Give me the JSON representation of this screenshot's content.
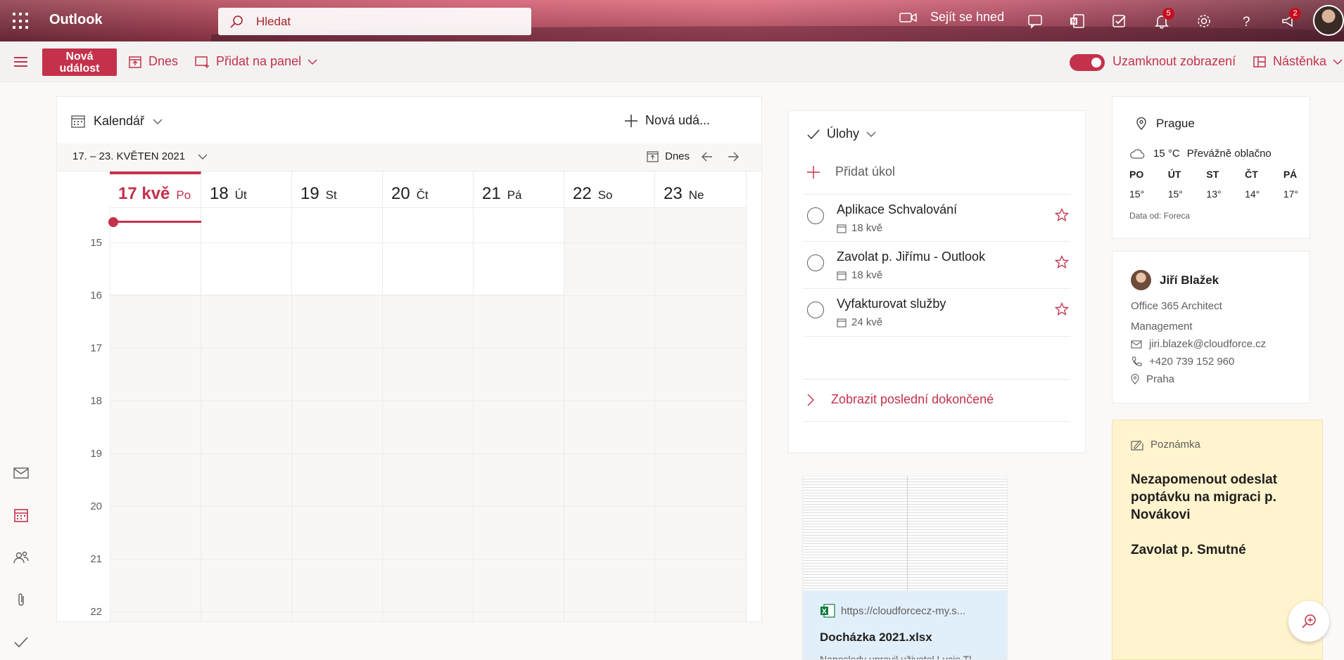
{
  "header": {
    "app_name": "Outlook",
    "search_placeholder": "Hledat",
    "meet_now_label": "Sejít se hned",
    "notifications_badge": "5",
    "feedback_badge": "2"
  },
  "toolbar": {
    "new_event_label": "Nová událost",
    "today_label": "Dnes",
    "add_to_board_label": "Přidat na panel",
    "lock_view_label": "Uzamknout zobrazení",
    "board_label": "Nástěnka",
    "lock_view_on": true
  },
  "calendar": {
    "title": "Kalendář",
    "new_event_label": "Nová udá...",
    "range_label": "17. – 23. KVĚTEN 2021",
    "today_label": "Dnes",
    "days": [
      {
        "num": "17 kvě",
        "name": "Po",
        "today": true
      },
      {
        "num": "18",
        "name": "Út"
      },
      {
        "num": "19",
        "name": "St"
      },
      {
        "num": "20",
        "name": "Čt"
      },
      {
        "num": "21",
        "name": "Pá"
      },
      {
        "num": "22",
        "name": "So"
      },
      {
        "num": "23",
        "name": "Ne"
      }
    ],
    "hours": [
      "15",
      "16",
      "17",
      "18",
      "19",
      "20",
      "21",
      "22"
    ]
  },
  "tasks": {
    "title": "Úlohy",
    "add_label": "Přidat úkol",
    "items": [
      {
        "name": "Aplikace Schvalování",
        "date": "18 kvě"
      },
      {
        "name": "Zavolat p. Jiřímu - Outlook",
        "date": "18 kvě"
      },
      {
        "name": "Vyfakturovat služby",
        "date": "24 kvě"
      }
    ],
    "show_completed_label": "Zobrazit poslední dokončené"
  },
  "file": {
    "url": "https://cloudforcecz-my.s...",
    "name": "Docházka 2021.xlsx",
    "modified": "Naposledy upravil uživatel Lucie Tl..."
  },
  "weather": {
    "location": "Prague",
    "temp": "15 °C",
    "condition": "Převážně oblačno",
    "days": [
      {
        "d": "PO",
        "t": "15°"
      },
      {
        "d": "ÚT",
        "t": "15°"
      },
      {
        "d": "ST",
        "t": "13°"
      },
      {
        "d": "ČT",
        "t": "14°"
      },
      {
        "d": "PÁ",
        "t": "17°"
      }
    ],
    "source": "Data od: Foreca"
  },
  "profile": {
    "name": "Jiří Blažek",
    "title": "Office 365 Architect",
    "department": "Management",
    "email": "jiri.blazek@cloudforce.cz",
    "phone": "+420 739 152 960",
    "location": "Praha"
  },
  "note": {
    "label": "Poznámka",
    "text": "Nezapomenout odeslat poptávku na migraci p. Novákovi\n\nZavolat p. Smutné"
  },
  "colors": {
    "accent": "#c4314b",
    "note_bg": "#fff4ce"
  }
}
